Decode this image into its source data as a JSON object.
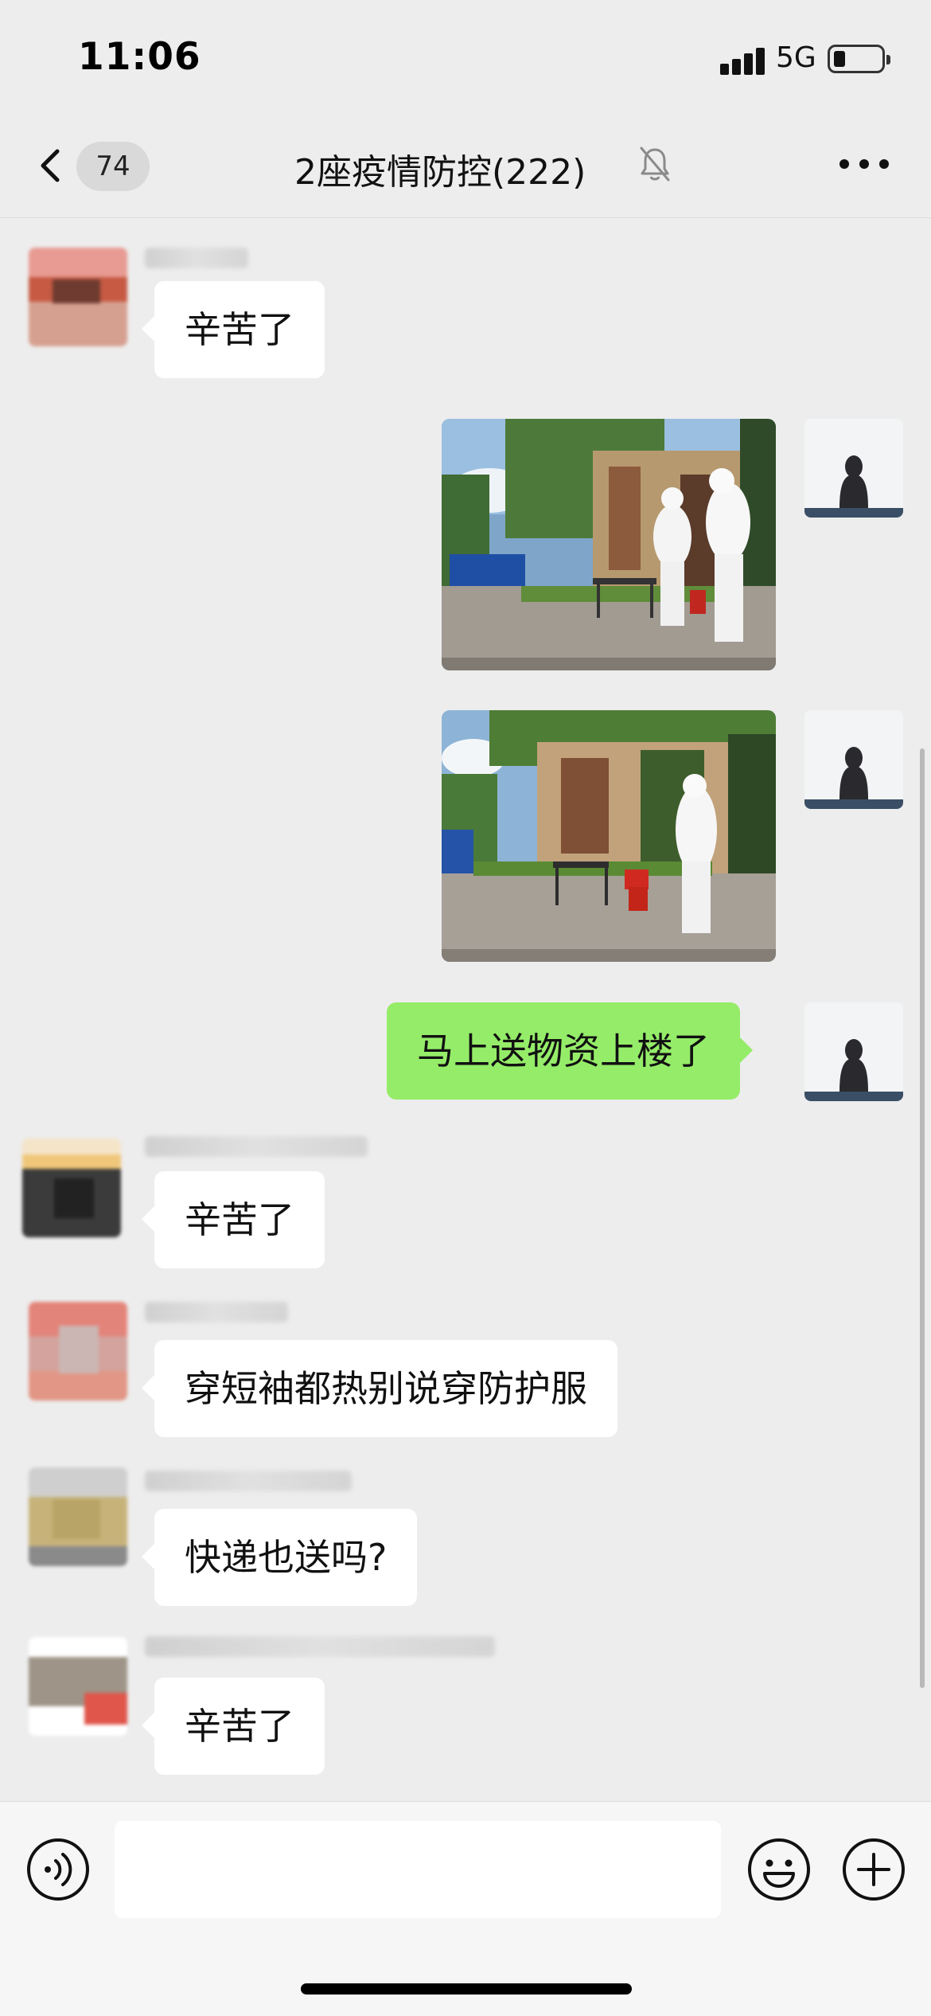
{
  "status_bar": {
    "time": "11:06",
    "network": "5G",
    "battery_level": 0.25
  },
  "nav": {
    "unread_count": "74",
    "title": "2座疫情防控(222)",
    "muted": true
  },
  "messages": [
    {
      "side": "in",
      "kind": "text",
      "text": "辛苦了"
    },
    {
      "side": "out",
      "kind": "image",
      "description": "photo"
    },
    {
      "side": "out",
      "kind": "image",
      "description": "photo"
    },
    {
      "side": "out",
      "kind": "text",
      "text": "马上送物资上楼了"
    },
    {
      "side": "in",
      "kind": "text",
      "text": "辛苦了"
    },
    {
      "side": "in",
      "kind": "text",
      "text": "穿短袖都热别说穿防护服"
    },
    {
      "side": "in",
      "kind": "text",
      "text": "快递也送吗?"
    },
    {
      "side": "in",
      "kind": "text",
      "text": "辛苦了"
    }
  ],
  "input": {
    "value": "",
    "placeholder": ""
  },
  "colors": {
    "background": "#ededed",
    "outgoing_bubble": "#95ec69",
    "incoming_bubble": "#ffffff"
  }
}
